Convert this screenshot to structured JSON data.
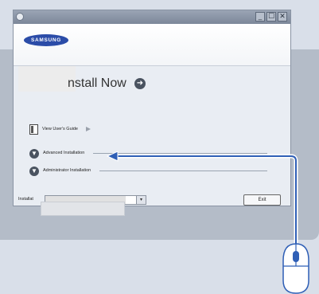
{
  "window": {
    "controls": {
      "minimize": "_",
      "maximize": "☐",
      "close": "✕"
    },
    "brand": {
      "logo_text": "SAMSUNG"
    }
  },
  "main": {
    "install_now_label": "nstall Now",
    "go_glyph": "➜",
    "view_guide_label": "View User's Guide",
    "options": [
      {
        "label": "Advanced Installation",
        "glyph": "▼"
      },
      {
        "label": "Administrator Installation",
        "glyph": "▼"
      }
    ],
    "language_label": "Installat",
    "dropdown_glyph": "▾",
    "exit_label": "Exit"
  },
  "colors": {
    "annotation_arrow": "#2f5fb6",
    "window_bg": "#e9edf3"
  },
  "icons": [
    "app-icon",
    "minimize-icon",
    "maximize-icon",
    "close-icon",
    "go-arrow-icon",
    "book-icon",
    "play-arrow-icon",
    "down-arrow-circle-icon",
    "mouse-icon",
    "callout-arrow-icon"
  ]
}
